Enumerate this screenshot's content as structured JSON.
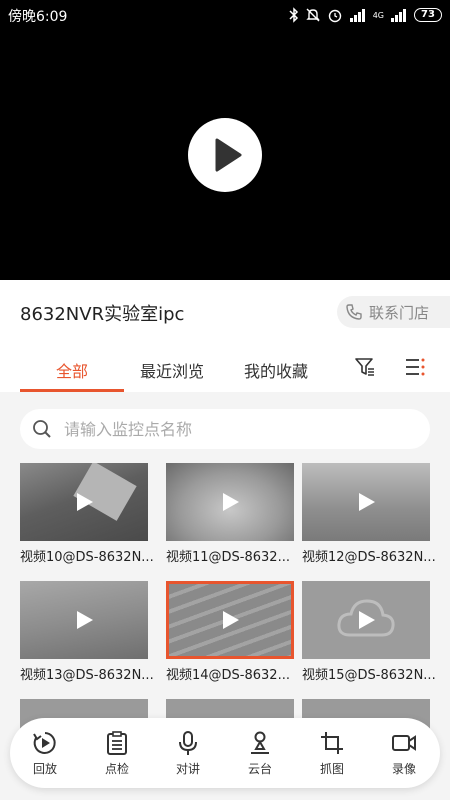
{
  "status_bar": {
    "time": "傍晚6:09",
    "battery": "73",
    "network": "4G"
  },
  "player": {
    "play_icon": "play-icon"
  },
  "device": {
    "name": "8632NVR实验室ipc",
    "contact_label": "联系门店"
  },
  "tabs": [
    {
      "label": "全部",
      "active": true
    },
    {
      "label": "最近浏览",
      "active": false
    },
    {
      "label": "我的收藏",
      "active": false
    }
  ],
  "search": {
    "placeholder": "请输入监控点名称"
  },
  "cameras": [
    {
      "label": "视频10@DS-8632N..."
    },
    {
      "label": "视频11@DS-8632..."
    },
    {
      "label": "视频12@DS-8632N..."
    },
    {
      "label": "视频13@DS-8632N..."
    },
    {
      "label": "视频14@DS-8632..."
    },
    {
      "label": "视频15@DS-8632N..."
    }
  ],
  "bottom_bar": [
    {
      "label": "回放",
      "icon": "playback-icon"
    },
    {
      "label": "点检",
      "icon": "checklist-icon"
    },
    {
      "label": "对讲",
      "icon": "microphone-icon"
    },
    {
      "label": "云台",
      "icon": "ptz-icon"
    },
    {
      "label": "抓图",
      "icon": "crop-icon"
    },
    {
      "label": "录像",
      "icon": "record-icon"
    }
  ],
  "colors": {
    "accent": "#e8552e",
    "background": "#f4f4f4"
  }
}
